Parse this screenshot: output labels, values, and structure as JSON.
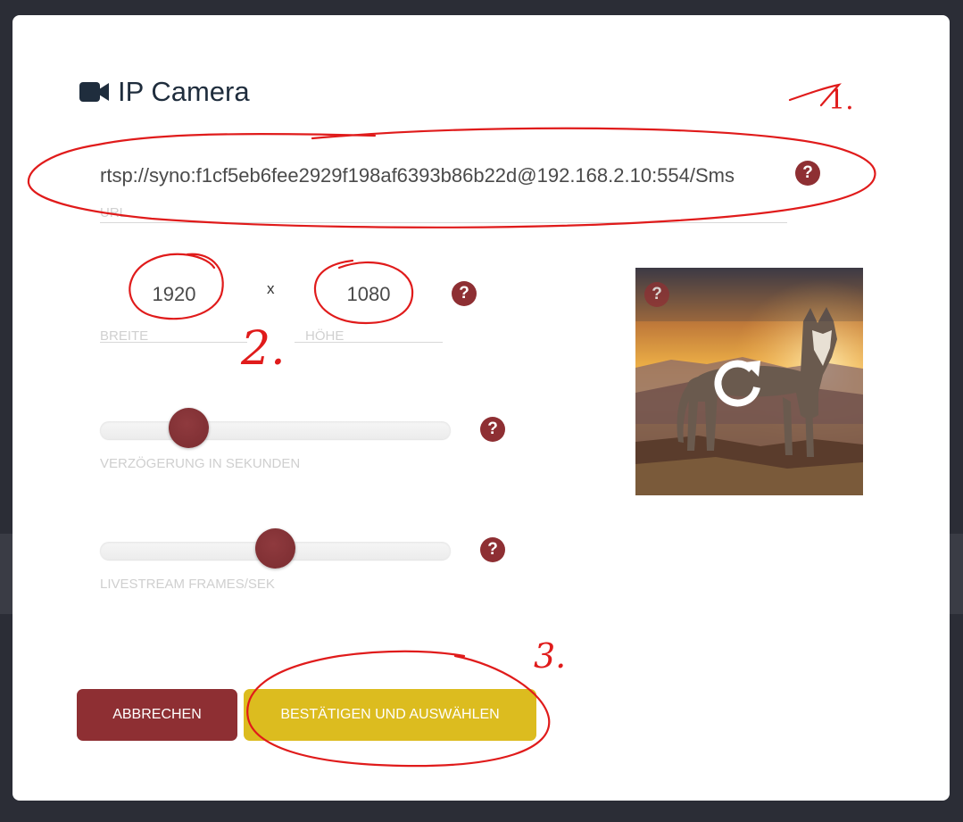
{
  "dialog": {
    "title": "IP Camera",
    "title_icon": "video-camera-icon"
  },
  "url_field": {
    "value": "rtsp://syno:f1cf5eb6fee2929f198af6393b86b22d@192.168.2.10:554/Sms",
    "label": "URL"
  },
  "dimensions": {
    "width_value": "1920",
    "width_label": "BREITE",
    "separator": "x",
    "height_value": "1080",
    "height_label": "HÖHE"
  },
  "sliders": {
    "delay": {
      "label": "VERZÖGERUNG IN SEKUNDEN",
      "fraction": 0.22
    },
    "fps": {
      "label": "LIVESTREAM FRAMES/SEK",
      "fraction": 0.5
    }
  },
  "help_glyph": "?",
  "preview": {
    "overlay_icon": "refresh-icon",
    "help_icon": "help-icon"
  },
  "buttons": {
    "cancel": "ABBRECHEN",
    "confirm": "BESTÄTIGEN UND AUSWÄHLEN"
  },
  "annotations": {
    "one": "1.",
    "two": "2.",
    "three": "3."
  },
  "colors": {
    "primary": "#8e2f33",
    "accent": "#dcbc1f",
    "annotation": "#e01b1b"
  }
}
